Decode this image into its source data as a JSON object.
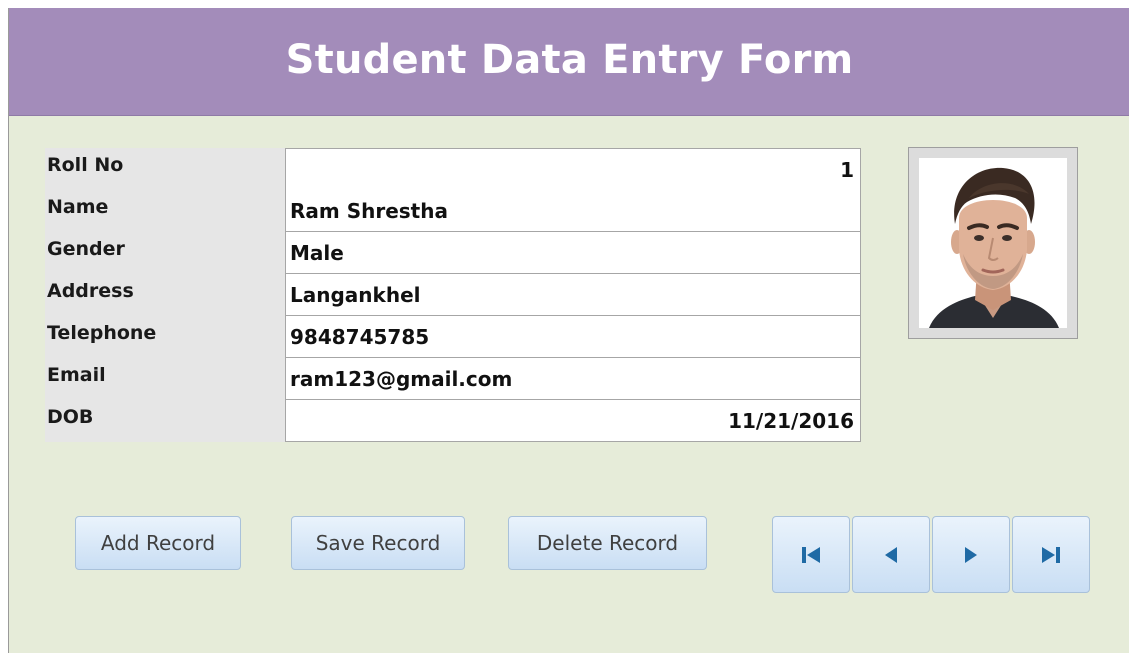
{
  "header": {
    "title": "Student Data Entry Form"
  },
  "fields": [
    {
      "label": "Roll No",
      "value": "1",
      "align": "right"
    },
    {
      "label": "Name",
      "value": "Ram Shrestha",
      "align": "left"
    },
    {
      "label": "Gender",
      "value": "Male",
      "align": "left"
    },
    {
      "label": "Address",
      "value": "Langankhel",
      "align": "left"
    },
    {
      "label": "Telephone",
      "value": "9848745785",
      "align": "left"
    },
    {
      "label": "Email",
      "value": "ram123@gmail.com",
      "align": "left"
    },
    {
      "label": "DOB",
      "value": "11/21/2016",
      "align": "right"
    }
  ],
  "actions": {
    "add_label": "Add Record",
    "save_label": "Save Record",
    "delete_label": "Delete Record"
  },
  "navigation": {
    "first_icon": "first-record-icon",
    "previous_icon": "previous-record-icon",
    "next_icon": "next-record-icon",
    "last_icon": "last-record-icon"
  },
  "colors": {
    "header_bg": "#a38cba",
    "form_bg": "#e6ecd9",
    "label_bg": "#e6e6e6",
    "button_top": "#eaf3fc",
    "button_bottom": "#c9def4",
    "nav_icon": "#1f6aa5"
  }
}
